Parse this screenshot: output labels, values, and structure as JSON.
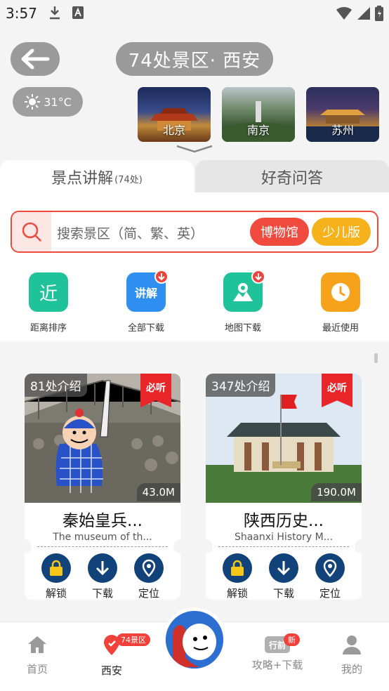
{
  "status": {
    "time": "3:57"
  },
  "header": {
    "title": "74处景区· 西安",
    "weather": "31°C"
  },
  "cities": [
    {
      "name": "北京"
    },
    {
      "name": "南京"
    },
    {
      "name": "苏州"
    }
  ],
  "tabs": {
    "guide": "景点讲解",
    "guide_count": "(74处)",
    "qa": "好奇问答"
  },
  "search": {
    "placeholder": "搜索景区（简、繁、英）",
    "museum": "博物馆",
    "kids": "少儿版"
  },
  "actions": [
    {
      "label": "距离排序",
      "glyph": "近",
      "color": "#20c29a",
      "icon": "near-icon"
    },
    {
      "label": "全部下载",
      "glyph": "讲解",
      "color": "#2e8ff0",
      "icon": "download-all-icon"
    },
    {
      "label": "地图下载",
      "color": "#20c29a",
      "icon": "map-icon"
    },
    {
      "label": "最近使用",
      "color": "#f6a21a",
      "icon": "clock-icon"
    }
  ],
  "cards": [
    {
      "count": "81处介绍",
      "flag": "必听",
      "size": "43.0M",
      "name": "秦始皇兵...",
      "en": "The museum of th...",
      "actions": [
        "解锁",
        "下载",
        "定位"
      ]
    },
    {
      "count": "347处介绍",
      "flag": "必听",
      "size": "190.0M",
      "name": "陕西历史...",
      "en": "Shaanxi History M...",
      "actions": [
        "解锁",
        "下载",
        "定位"
      ]
    }
  ],
  "bottom_nav": {
    "home": "首页",
    "city": "西安",
    "city_badge": "74景区",
    "guide": "攻略+下载",
    "guide_badge": "新",
    "guide_icon_text": "行前",
    "me": "我的"
  },
  "colors": {
    "accent_red": "#f04a3e",
    "accent_yellow": "#f6b21a",
    "navy": "#12427a"
  }
}
